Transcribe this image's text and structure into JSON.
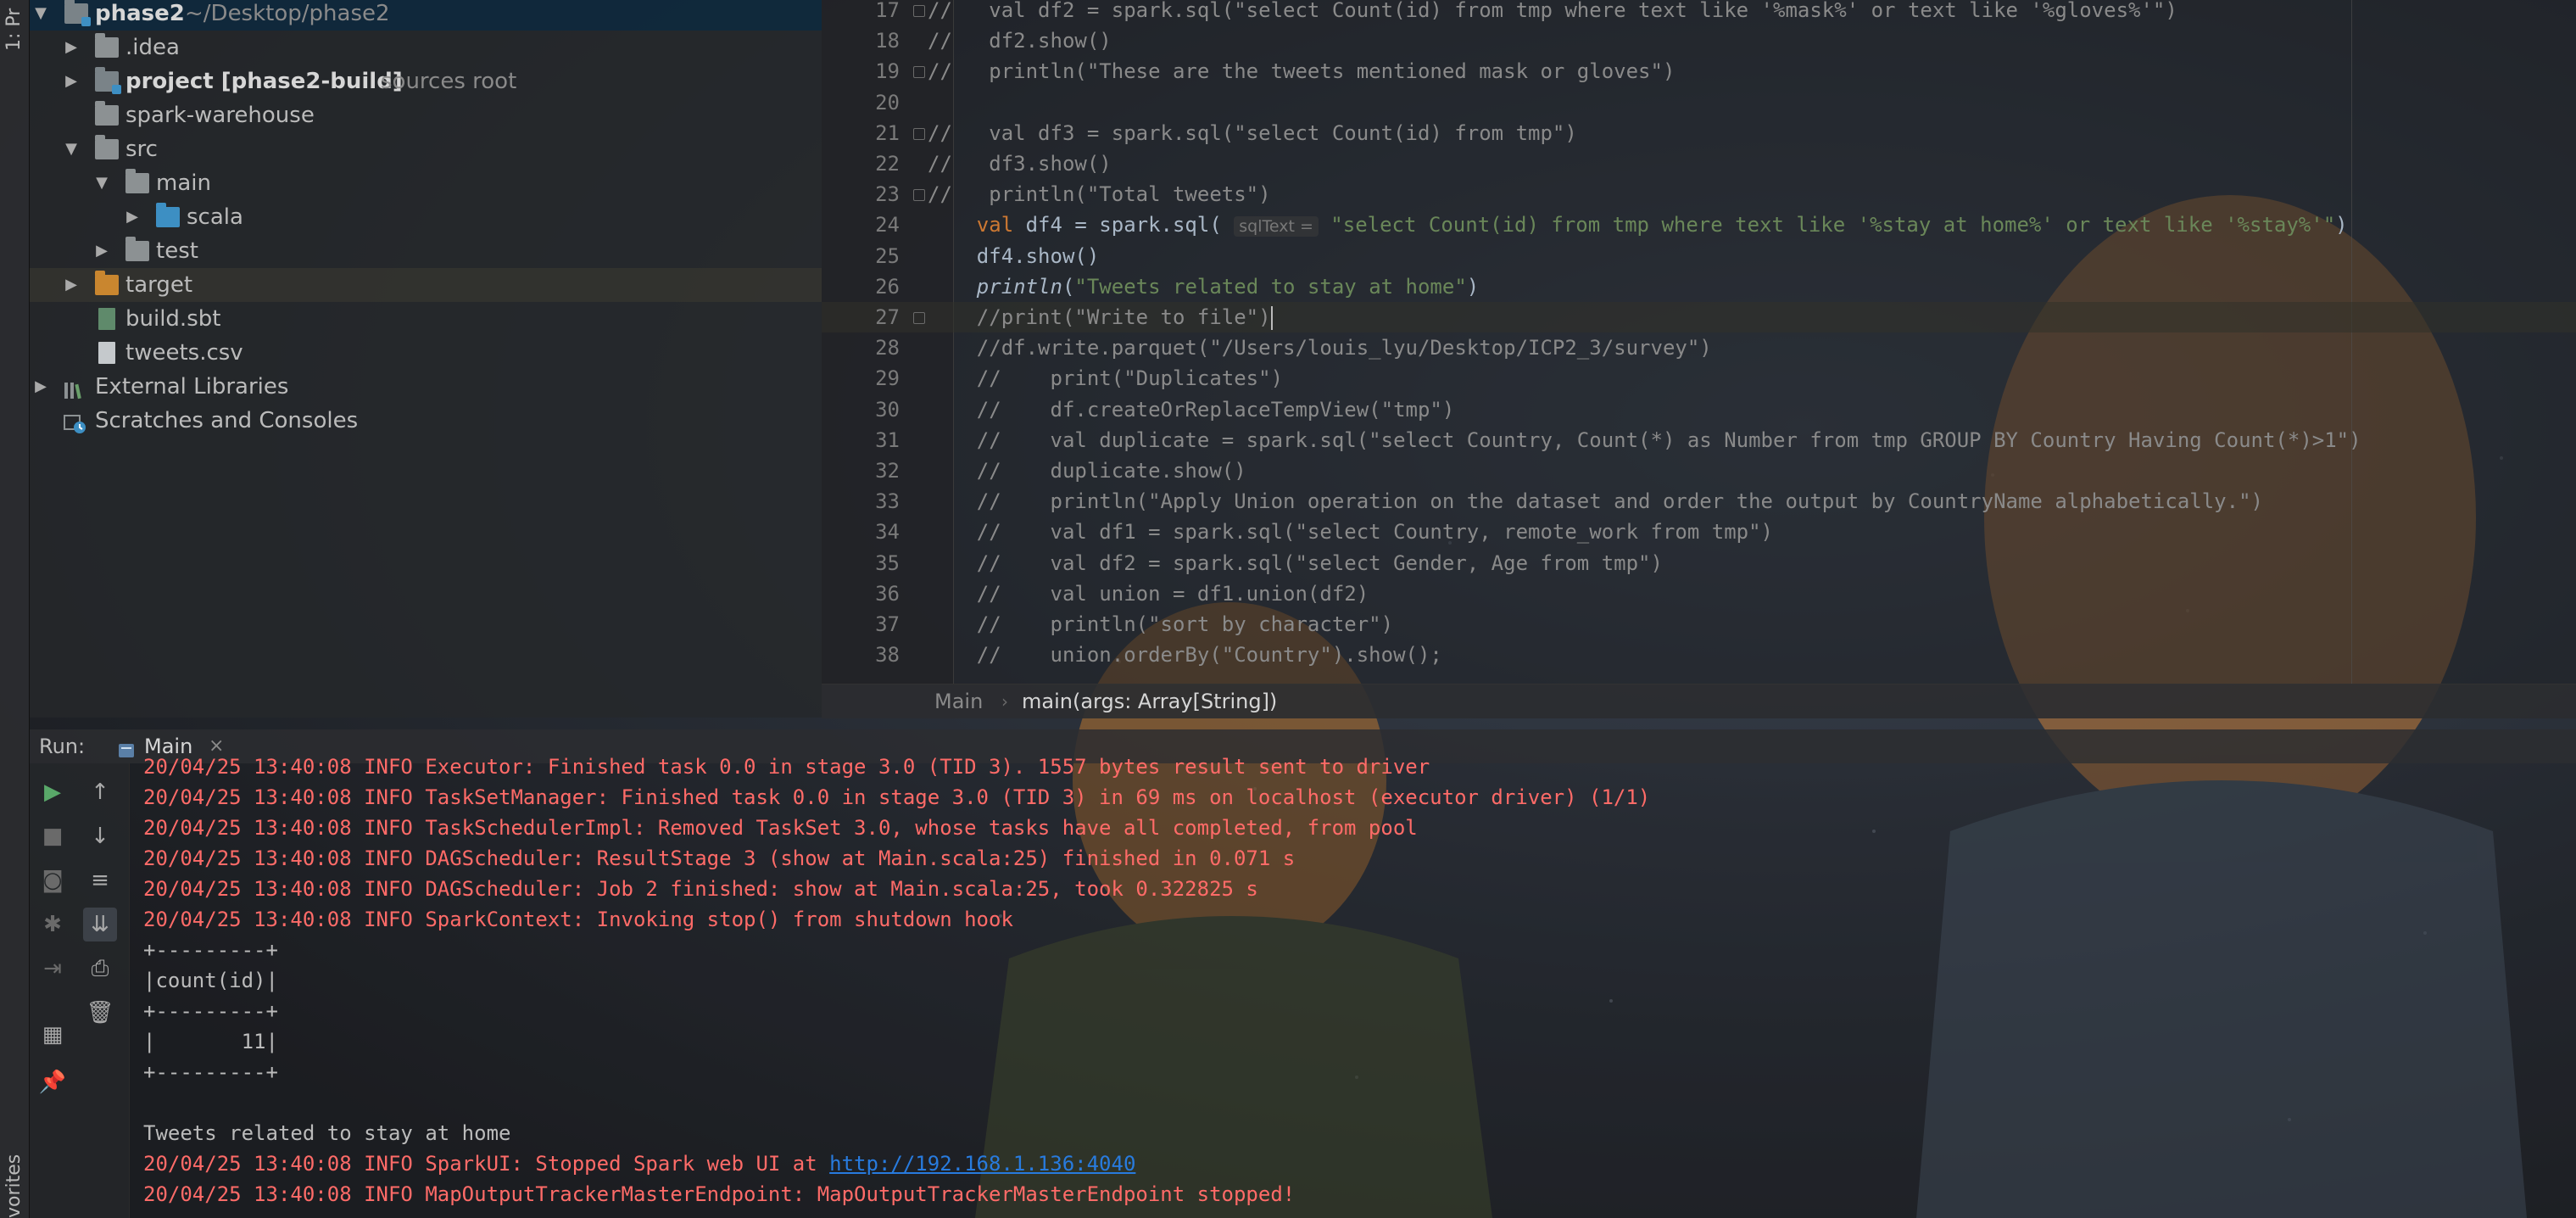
{
  "left_strip": {
    "project_tab": "1: Pr",
    "favorites_tab": "vorites"
  },
  "project_tree": [
    {
      "label": "phase2",
      "extra": "~/Desktop/phase2",
      "icon": "module-folder-icon",
      "expanded": true,
      "selected": true
    },
    {
      "label": ".idea",
      "extra": "",
      "icon": "folder-icon",
      "expanded": false
    },
    {
      "label": "project [phase2-build]",
      "extra": "sources root",
      "icon": "module-folder-icon",
      "expanded": false
    },
    {
      "label": "spark-warehouse",
      "extra": "",
      "icon": "folder-icon",
      "expanded": null
    },
    {
      "label": "src",
      "extra": "",
      "icon": "folder-icon",
      "expanded": true
    },
    {
      "label": "main",
      "extra": "",
      "icon": "folder-icon",
      "expanded": true
    },
    {
      "label": "scala",
      "extra": "",
      "icon": "source-folder-icon",
      "expanded": false
    },
    {
      "label": "test",
      "extra": "",
      "icon": "folder-icon",
      "expanded": false
    },
    {
      "label": "target",
      "extra": "",
      "icon": "excluded-folder-icon",
      "expanded": false
    },
    {
      "label": "build.sbt",
      "extra": "",
      "icon": "sbt-file-icon",
      "expanded": null
    },
    {
      "label": "tweets.csv",
      "extra": "",
      "icon": "csv-file-icon",
      "expanded": null
    },
    {
      "label": "External Libraries",
      "extra": "",
      "icon": "libraries-icon",
      "expanded": false
    },
    {
      "label": "Scratches and Consoles",
      "extra": "",
      "icon": "scratches-icon",
      "expanded": null
    }
  ],
  "editor": {
    "current_line": 27,
    "lines": [
      {
        "n": "17",
        "segments": [
          [
            "c-comment",
            "//   val df2 = spark.sql(\"select Count(id) from tmp where text like '%mask%' or text like '%gloves%'\")"
          ]
        ]
      },
      {
        "n": "18",
        "segments": [
          [
            "c-comment",
            "//   df2.show()"
          ]
        ]
      },
      {
        "n": "19",
        "segments": [
          [
            "c-comment",
            "//   println(\"These are the tweets mentioned mask or gloves\")"
          ]
        ]
      },
      {
        "n": "20",
        "segments": []
      },
      {
        "n": "21",
        "segments": [
          [
            "c-comment",
            "//   val df3 = spark.sql(\"select Count(id) from tmp\")"
          ]
        ]
      },
      {
        "n": "22",
        "segments": [
          [
            "c-comment",
            "//   df3.show()"
          ]
        ]
      },
      {
        "n": "23",
        "segments": [
          [
            "c-comment",
            "//   println(\"Total tweets\")"
          ]
        ]
      },
      {
        "n": "24",
        "segments": [
          [
            "c-kw",
            "    val "
          ],
          [
            "c-plain",
            "df4 = spark.sql( "
          ],
          [
            "hint",
            "sqlText ="
          ],
          [
            "c-str",
            " \"select Count(id) from tmp where text like '%stay at home%' or text like '%stay%'\""
          ],
          [
            "c-plain",
            ")"
          ]
        ]
      },
      {
        "n": "25",
        "segments": [
          [
            "c-plain",
            "    df4.show()"
          ]
        ]
      },
      {
        "n": "26",
        "segments": [
          [
            "c-plain c-italic",
            "    println"
          ],
          [
            "c-plain",
            "("
          ],
          [
            "c-str",
            "\"Tweets related to stay at home\""
          ],
          [
            "c-plain",
            ")"
          ]
        ]
      },
      {
        "n": "27",
        "segments": [
          [
            "c-comment",
            "    //print(\"Write to file\")"
          ],
          [
            "caret",
            ""
          ]
        ]
      },
      {
        "n": "28",
        "segments": [
          [
            "c-comment",
            "    //df.write.parquet(\"/Users/louis_lyu/Desktop/ICP2_3/survey\")"
          ]
        ]
      },
      {
        "n": "29",
        "segments": [
          [
            "c-comment",
            "    //    print(\"Duplicates\")"
          ]
        ]
      },
      {
        "n": "30",
        "segments": [
          [
            "c-comment",
            "    //    df.createOrReplaceTempView(\"tmp\")"
          ]
        ]
      },
      {
        "n": "31",
        "segments": [
          [
            "c-comment",
            "    //    val duplicate = spark.sql(\"select Country, Count(*) as Number from tmp GROUP BY Country Having Count(*)>1\")"
          ]
        ]
      },
      {
        "n": "32",
        "segments": [
          [
            "c-comment",
            "    //    duplicate.show()"
          ]
        ]
      },
      {
        "n": "33",
        "segments": [
          [
            "c-comment",
            "    //    println(\"Apply Union operation on the dataset and order the output by CountryName alphabetically.\")"
          ]
        ]
      },
      {
        "n": "34",
        "segments": [
          [
            "c-comment",
            "    //    val df1 = spark.sql(\"select Country, remote_work from tmp\")"
          ]
        ]
      },
      {
        "n": "35",
        "segments": [
          [
            "c-comment",
            "    //    val df2 = spark.sql(\"select Gender, Age from tmp\")"
          ]
        ]
      },
      {
        "n": "36",
        "segments": [
          [
            "c-comment",
            "    //    val union = df1.union(df2)"
          ]
        ]
      },
      {
        "n": "37",
        "segments": [
          [
            "c-comment",
            "    //    println(\"sort by character\")"
          ]
        ]
      },
      {
        "n": "38",
        "segments": [
          [
            "c-comment",
            "    //    union.orderBy(\"Country\").show();"
          ]
        ]
      }
    ]
  },
  "breadcrumb": {
    "items": [
      "Main",
      "main(args: Array[String])"
    ]
  },
  "run": {
    "title": "Run:",
    "tab_label": "Main",
    "console_lines": [
      {
        "text": "20/04/25 13:40:08 INFO Executor: Finished task 0.0 in stage 3.0 (TID 3). 1557 bytes result sent to driver",
        "kind": "err"
      },
      {
        "text": "20/04/25 13:40:08 INFO TaskSetManager: Finished task 0.0 in stage 3.0 (TID 3) in 69 ms on localhost (executor driver) (1/1)",
        "kind": "err"
      },
      {
        "text": "20/04/25 13:40:08 INFO TaskSchedulerImpl: Removed TaskSet 3.0, whose tasks have all completed, from pool",
        "kind": "err"
      },
      {
        "text": "20/04/25 13:40:08 INFO DAGScheduler: ResultStage 3 (show at Main.scala:25) finished in 0.071 s",
        "kind": "err"
      },
      {
        "text": "20/04/25 13:40:08 INFO DAGScheduler: Job 2 finished: show at Main.scala:25, took 0.322825 s",
        "kind": "err"
      },
      {
        "text": "20/04/25 13:40:08 INFO SparkContext: Invoking stop() from shutdown hook",
        "kind": "err"
      },
      {
        "text": "+---------+",
        "kind": "out"
      },
      {
        "text": "|count(id)|",
        "kind": "out"
      },
      {
        "text": "+---------+",
        "kind": "out"
      },
      {
        "text": "|       11|",
        "kind": "out"
      },
      {
        "text": "+---------+",
        "kind": "out"
      },
      {
        "text": "",
        "kind": "out"
      },
      {
        "text": "Tweets related to stay at home",
        "kind": "out"
      },
      {
        "text": "20/04/25 13:40:08 INFO SparkUI: Stopped Spark web UI at ",
        "link": "http://192.168.1.136:4040",
        "kind": "err"
      },
      {
        "text": "20/04/25 13:40:08 INFO MapOutputTrackerMasterEndpoint: MapOutputTrackerMasterEndpoint stopped!",
        "kind": "err"
      }
    ]
  },
  "colors": {
    "console_error": "#ff6b68",
    "link": "#287bde",
    "string": "#6a8759",
    "keyword": "#cc7832",
    "comment": "#8a8a8a",
    "selection": "#0d293e"
  }
}
